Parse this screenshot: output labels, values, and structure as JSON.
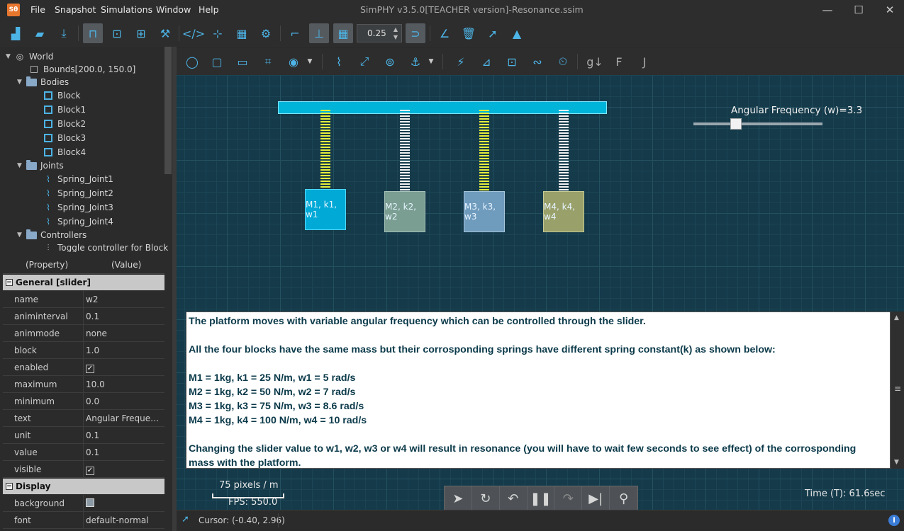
{
  "app": {
    "logo": "Sθ",
    "title": "SimPHY v3.5.0[TEACHER version]-Resonance.ssim",
    "menu": [
      "File",
      "Snapshot",
      "Simulations",
      "Window",
      "Help"
    ]
  },
  "toolbar": {
    "zoom_value": "0.25"
  },
  "tree": {
    "root": "World",
    "bounds": "Bounds[200.0, 150.0]",
    "bodies_label": "Bodies",
    "bodies": [
      "Block",
      "Block1",
      "Block2",
      "Block3",
      "Block4"
    ],
    "joints_label": "Joints",
    "joints": [
      "Spring_Joint1",
      "Spring_Joint2",
      "Spring_Joint3",
      "Spring_Joint4"
    ],
    "controllers_label": "Controllers",
    "controllers": [
      "Toggle controller for Block"
    ]
  },
  "properties": {
    "header_property": "(Property)",
    "header_value": "(Value)",
    "general_section": "General [slider]",
    "general": [
      {
        "name": "name",
        "value": "w2"
      },
      {
        "name": "animinterval",
        "value": "0.1"
      },
      {
        "name": "animmode",
        "value": "none"
      },
      {
        "name": "block",
        "value": "1.0"
      },
      {
        "name": "enabled",
        "value": "✓"
      },
      {
        "name": "maximum",
        "value": "10.0"
      },
      {
        "name": "minimum",
        "value": "0.0"
      },
      {
        "name": "text",
        "value": "Angular Frequenc..."
      },
      {
        "name": "unit",
        "value": "0.1"
      },
      {
        "name": "value",
        "value": "0.1"
      },
      {
        "name": "visible",
        "value": "✓"
      }
    ],
    "display_section": "Display",
    "display": [
      {
        "name": "background",
        "value": ""
      },
      {
        "name": "font",
        "value": "default-normal"
      }
    ]
  },
  "simulation": {
    "blocks": [
      {
        "label": "M1, k1, w1",
        "fill": "#00a9d6",
        "border": "#4fd8ff",
        "spring_color": "#e6ee3a"
      },
      {
        "label": "M2, k2, w2",
        "fill": "#7a9e91",
        "border": "#a9c4bb",
        "spring_color": "#f2f2f2"
      },
      {
        "label": "M3, k3, w3",
        "fill": "#6f9bbd",
        "border": "#a7c6dc",
        "spring_color": "#e6ee3a"
      },
      {
        "label": "M4, k4, w4",
        "fill": "#9aa06a",
        "border": "#c7cc93",
        "spring_color": "#f2f2f2"
      }
    ],
    "slider": {
      "label": "Angular Frequency (w)=3.3",
      "value": 3.3,
      "min": 0.0,
      "max": 10.0
    },
    "info_lines": [
      "The platform moves with variable angular frequency which can be controlled through the slider.",
      "",
      "All the four blocks have the same mass but their corrosponding springs have different spring constant(k) as shown below:",
      "",
      "M1 = 1kg, k1 = 25 N/m, w1 = 5 rad/s",
      "M2 = 1kg, k2 = 50 N/m, w2 = 7 rad/s",
      "M3 = 1kg, k3 = 75 N/m, w3 = 8.6 rad/s",
      "M4 = 1kg, k4 = 100 N/m, w4 = 10 rad/s",
      "",
      "Changing the slider value to w1, w2, w3 or w4 will result in resonance (you will have to wait few seconds to see effect) of the corrosponding",
      "mass with the platform."
    ],
    "scale_label": "75 pixels / m",
    "fps_label": "FPS: 550.0",
    "time_label": "Time (T): 61.6sec"
  },
  "status": {
    "cursor": "Cursor: (-0.40, 2.96)"
  }
}
